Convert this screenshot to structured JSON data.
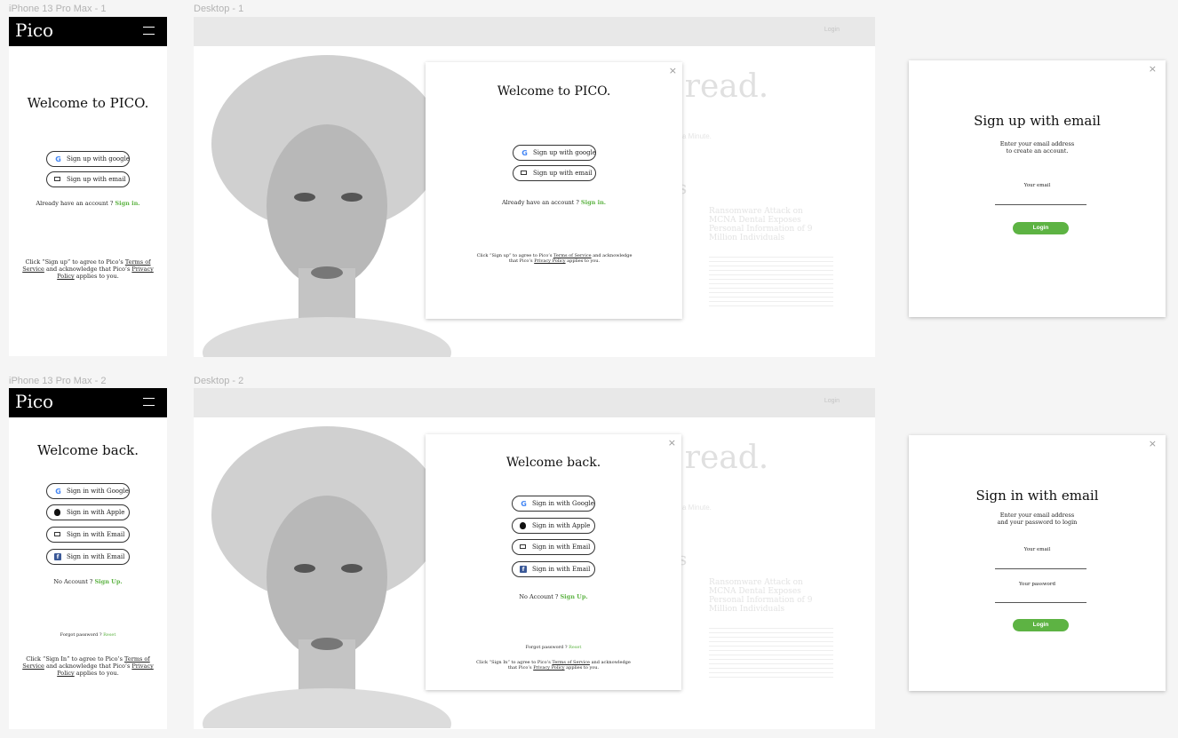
{
  "frames": {
    "phone1": "iPhone 13 Pro Max - 1",
    "desktop1": "Desktop - 1",
    "phone2": "iPhone 13 Pro Max - 2",
    "desktop2": "Desktop - 2"
  },
  "brand": {
    "logo": "Pico",
    "accent": "#5db343"
  },
  "nav": {
    "login": "Login"
  },
  "background": {
    "headline": "e read.",
    "tagline": "a Minute.",
    "article_title": "Ransomware Attack on MCNA Dental Exposes Personal Information of 9 Million Individuals",
    "section_fragment": "s"
  },
  "signup": {
    "title": "Welcome to PICO.",
    "google": "Sign up with google",
    "email": "Sign up with email",
    "already_prefix": "Already have an account ?",
    "already_link": "Sign in.",
    "legal_pre": "Click “Sign up” to agree to Pico’s",
    "terms": "Terms of Service",
    "legal_mid": "and acknowledge that Pico’s",
    "privacy": "Privacy Policy",
    "legal_post": "applies to you."
  },
  "signin": {
    "title": "Welcome back.",
    "google": "Sign in with Google",
    "apple": "Sign in with Apple",
    "email": "Sign in with Email",
    "facebook": "Sign in with Email",
    "no_account_prefix": "No Account ?",
    "no_account_link": "Sign Up.",
    "forgot_prefix": "Forgot password ?",
    "forgot_link": "Reset",
    "legal_pre": "Click “Sign In” to agree to Pico’s",
    "terms": "Terms of Service",
    "legal_mid": "and acknowledge that Pico’s",
    "privacy": "Privacy Policy",
    "legal_post": "applies to you."
  },
  "email_signup": {
    "title": "Sign up with email",
    "subtitle_1": "Enter your email address",
    "subtitle_2": "to create an account.",
    "email_label": "Your email",
    "button": "Login"
  },
  "email_signin": {
    "title": "Sign in with email",
    "subtitle_1": "Enter your email address",
    "subtitle_2": "and your password to login",
    "email_label": "Your email",
    "password_label": "Your password",
    "button": "Login"
  },
  "icons": {
    "close": "×",
    "google": "G",
    "facebook": "f"
  }
}
